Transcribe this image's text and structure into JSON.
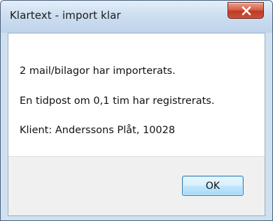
{
  "window": {
    "title": "Klartext - import klar",
    "close_icon": "close-icon"
  },
  "message": {
    "line1": "2 mail/bilagor har importerats.",
    "line2": "En tidpost om 0,1 tim har registrerats.",
    "line3": "Klient: Anderssons Plåt, 10028"
  },
  "buttons": {
    "ok_label": "OK"
  },
  "colors": {
    "titlebar": "#cddef0",
    "close_button": "#c9523b",
    "ok_button": "#bee6fd"
  }
}
